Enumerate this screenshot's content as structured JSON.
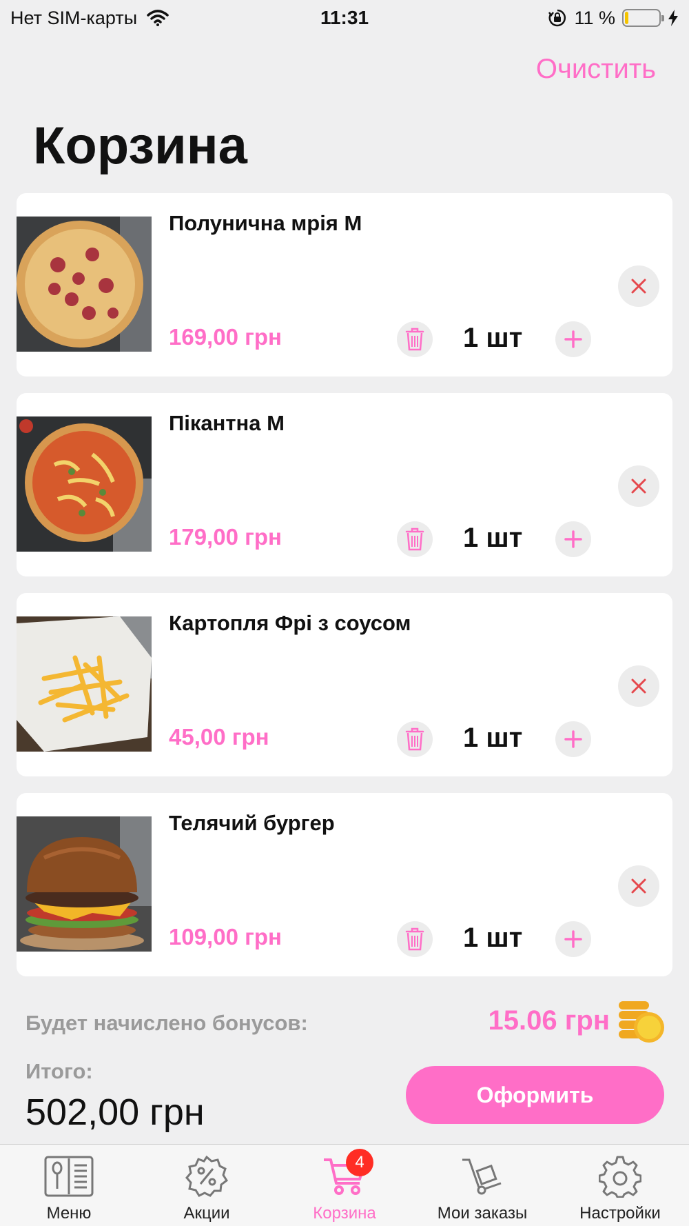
{
  "status_bar": {
    "carrier": "Нет SIM-карты",
    "time": "11:31",
    "battery_text": "11 %",
    "battery_level": 0.11
  },
  "header": {
    "clear_label": "Очистить",
    "title": "Корзина"
  },
  "items": [
    {
      "name": "Полунична мрія M",
      "price": "169,00 грн",
      "qty": "1 шт"
    },
    {
      "name": "Пікантна M",
      "price": "179,00 грн",
      "qty": "1 шт"
    },
    {
      "name": "Картопля Фрі з соусом",
      "price": "45,00 грн",
      "qty": "1 шт"
    },
    {
      "name": "Телячий бургер",
      "price": "109,00 грн",
      "qty": "1 шт"
    }
  ],
  "summary": {
    "bonus_label": "Будет начислено бонусов:",
    "bonus_value": "15.06 грн",
    "total_label": "Итого:",
    "total_value": "502,00 грн",
    "checkout_label": "Оформить"
  },
  "tabs": [
    {
      "label": "Меню",
      "icon": "menu-book-icon"
    },
    {
      "label": "Акции",
      "icon": "percent-badge-icon"
    },
    {
      "label": "Корзина",
      "icon": "cart-icon",
      "badge": "4",
      "active": true
    },
    {
      "label": "Мои заказы",
      "icon": "hand-truck-icon"
    },
    {
      "label": "Настройки",
      "icon": "gear-icon"
    }
  ],
  "colors": {
    "accent": "#ff6ec7",
    "background": "#efeff0",
    "badge": "#ff2d24",
    "remove": "#e5484d"
  }
}
